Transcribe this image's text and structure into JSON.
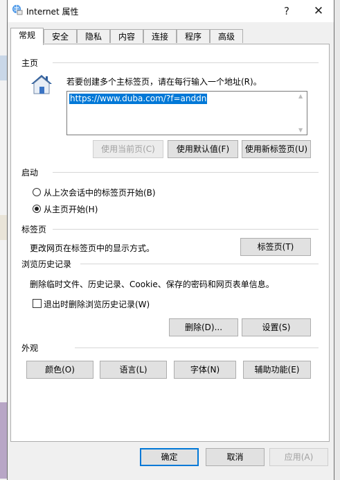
{
  "window": {
    "title": "Internet 属性",
    "help": "?",
    "close": "✕"
  },
  "tabs": [
    {
      "label": "常规"
    },
    {
      "label": "安全"
    },
    {
      "label": "隐私"
    },
    {
      "label": "内容"
    },
    {
      "label": "连接"
    },
    {
      "label": "程序"
    },
    {
      "label": "高级"
    }
  ],
  "home": {
    "title": "主页",
    "instruction": "若要创建多个主标签页，请在每行输入一个地址(R)。",
    "url": "https://www.duba.com/?f=anddn",
    "btn_current": "使用当前页(C)",
    "btn_default": "使用默认值(F)",
    "btn_newtab": "使用新标签页(U)"
  },
  "startup": {
    "title": "启动",
    "opt_last": "从上次会话中的标签页开始(B)",
    "opt_home": "从主页开始(H)"
  },
  "tabsgroup": {
    "title": "标签页",
    "desc": "更改网页在标签页中的显示方式。",
    "btn": "标签页(T)"
  },
  "history": {
    "title": "浏览历史记录",
    "desc": "删除临时文件、历史记录、Cookie、保存的密码和网页表单信息。",
    "check_label": "退出时删除浏览历史记录(W)",
    "btn_delete": "删除(D)...",
    "btn_settings": "设置(S)"
  },
  "appearance": {
    "title": "外观",
    "btn_colors": "颜色(O)",
    "btn_languages": "语言(L)",
    "btn_fonts": "字体(N)",
    "btn_accessibility": "辅助功能(E)"
  },
  "footer": {
    "ok": "确定",
    "cancel": "取消",
    "apply": "应用(A)"
  },
  "colors": {
    "accent": "#0078d7",
    "selection": "#0078d7"
  }
}
